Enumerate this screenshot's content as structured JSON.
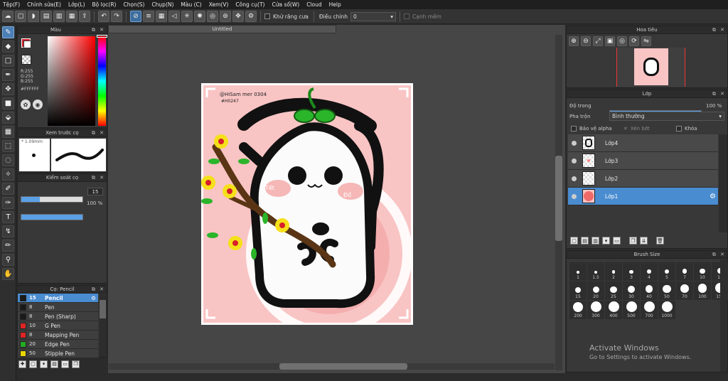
{
  "menu": [
    "Tệp(F)",
    "Chỉnh sửa(E)",
    "Lớp(L)",
    "Bộ lọc(R)",
    "Chọn(S)",
    "Chụp(N)",
    "Màu (C)",
    "Xem(V)",
    "Công cụ(T)",
    "Cửa sổ(W)",
    "Cloud",
    "Help"
  ],
  "toolbar": {
    "antialias_label": "Khử răng cưa",
    "correction_label": "Điều chỉnh",
    "correction_value": "0",
    "snap_label": "Cạnh mềm"
  },
  "color_panel": {
    "title": "Màu",
    "r": "R:255",
    "g": "G:255",
    "b": "B:255",
    "hex": "#FFFFFF",
    "fg": "#FFFFFF",
    "bg": "#D81E2B"
  },
  "preview_panel": {
    "title": "Xem trước cọ",
    "size": "1.09mm"
  },
  "brush_control": {
    "title": "Kiểm soát cọ",
    "size_value": "15",
    "size_fraction": 0.3,
    "opacity_value": "100 %",
    "opacity_fraction": 1.0
  },
  "brush_list": {
    "title": "Cọ: Pencil",
    "items": [
      {
        "size": "15",
        "name": "Pencil",
        "color": "#1a1a1a",
        "selected": true
      },
      {
        "size": "8",
        "name": "Pen",
        "color": "#1a1a1a",
        "selected": false
      },
      {
        "size": "8",
        "name": "Pen (Sharp)",
        "color": "#1a1a1a",
        "selected": false
      },
      {
        "size": "10",
        "name": "G Pen",
        "color": "#e02424",
        "selected": false
      },
      {
        "size": "8",
        "name": "Mapping Pen",
        "color": "#e02424",
        "selected": false
      },
      {
        "size": "20",
        "name": "Edge Pen",
        "color": "#22aa22",
        "selected": false
      },
      {
        "size": "50",
        "name": "Stipple Pen",
        "color": "#e8d800",
        "selected": false
      }
    ]
  },
  "document": {
    "tab_title": "Untitled",
    "handle": "@HiSam mer 0304",
    "tag": "#H0247",
    "bg": "#f9c4c4",
    "cheek_text_left": "Tết",
    "cheek_text_right": "Đổ"
  },
  "navigator": {
    "title": "Hoa tiêu"
  },
  "layers": {
    "title": "Lớp",
    "opacity_label": "Độ trong",
    "opacity_value": "100 %",
    "opacity_fraction": 1.0,
    "blend_label": "Pha trộn",
    "blend_value": "Bình thường",
    "protect_alpha": "Bảo vệ alpha",
    "clipping": "Xén bớt",
    "lock": "Khóa",
    "items": [
      {
        "name": "Lớp4",
        "selected": false
      },
      {
        "name": "Lớp3",
        "selected": false
      },
      {
        "name": "Lớp2",
        "selected": false
      },
      {
        "name": "Lớp1",
        "selected": true
      }
    ]
  },
  "brush_size": {
    "title": "Brush Size",
    "sizes": [
      "1",
      "1.5",
      "2",
      "3",
      "4",
      "5",
      "7",
      "10",
      "12",
      "15",
      "20",
      "25",
      "30",
      "40",
      "50",
      "70",
      "100",
      "150",
      "200",
      "300",
      "400",
      "500",
      "700",
      "1000"
    ]
  },
  "watermark": {
    "line1": "Activate Windows",
    "line2": "Go to Settings to activate Windows."
  }
}
